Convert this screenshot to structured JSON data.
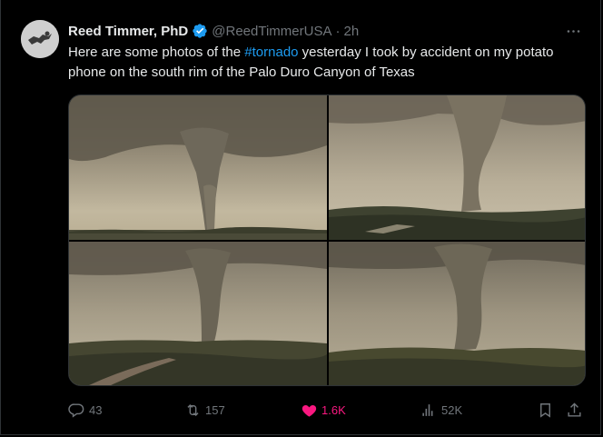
{
  "tweet": {
    "author_name": "Reed Timmer, PhD",
    "handle": "@ReedTimmerUSA",
    "separator": "·",
    "time": "2h",
    "text_before": "Here are some photos of the ",
    "hashtag": "#tornado",
    "text_after": " yesterday I took by accident on my potato phone on the south rim of the Palo Duro Canyon of Texas",
    "verified_color": "#1d9bf0"
  },
  "media": {
    "count": 4,
    "subject": "tornado photos"
  },
  "actions": {
    "replies": "43",
    "reposts": "157",
    "likes": "1.6K",
    "views": "52K",
    "like_color": "#f91880"
  },
  "icons": [
    "more-icon",
    "verified-icon",
    "reply-icon",
    "repost-icon",
    "like-icon",
    "views-icon",
    "bookmark-icon",
    "share-icon"
  ]
}
